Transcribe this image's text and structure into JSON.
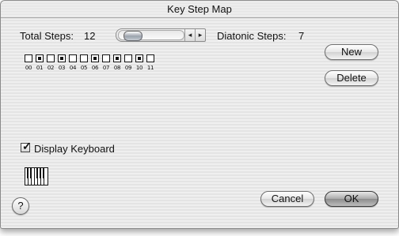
{
  "window": {
    "title": "Key Step Map"
  },
  "steps": {
    "total_label": "Total Steps:",
    "total_value": "12",
    "diatonic_label": "Diatonic Steps:",
    "diatonic_value": "7"
  },
  "scroller": {
    "left_arrow": "◂",
    "right_arrow": "▸"
  },
  "key_map": {
    "numbers": [
      "00",
      "01",
      "02",
      "03",
      "04",
      "05",
      "06",
      "07",
      "08",
      "09",
      "10",
      "11"
    ],
    "black_keys": [
      1,
      3,
      6,
      8,
      10
    ]
  },
  "buttons": {
    "new": "New",
    "delete": "Delete",
    "cancel": "Cancel",
    "ok": "OK",
    "help": "?"
  },
  "display_keyboard": {
    "label": "Display Keyboard",
    "checked": true,
    "mark": "✓"
  }
}
